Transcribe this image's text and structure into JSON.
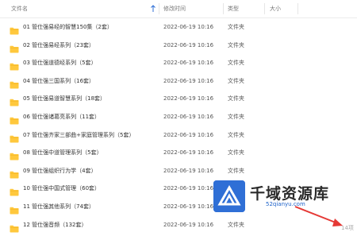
{
  "columns": {
    "name": "文件名",
    "modified": "修改时间",
    "type": "类型",
    "size": "大小"
  },
  "files": [
    {
      "name": "01 管仕强易经的智慧150集（2套）",
      "modified": "2022-06-19 10:16",
      "type": "文件夹"
    },
    {
      "name": "02 管仕强易经系列（23套）",
      "modified": "2022-06-19 10:16",
      "type": "文件夹"
    },
    {
      "name": "03 管仕强道德经系列（5套）",
      "modified": "2022-06-19 10:16",
      "type": "文件夹"
    },
    {
      "name": "04 管仕强三国系列（16套）",
      "modified": "2022-06-19 10:16",
      "type": "文件夹"
    },
    {
      "name": "05 管仕强易道智慧系列（18套）",
      "modified": "2022-06-19 10:16",
      "type": "文件夹"
    },
    {
      "name": "06 管仕强诸葛亮系列（11套）",
      "modified": "2022-06-19 10:16",
      "type": "文件夹"
    },
    {
      "name": "07 管仕强齐家三部曲+家庭管理系列（5套）",
      "modified": "2022-06-19 10:16",
      "type": "文件夹"
    },
    {
      "name": "08 管仕强中道管理系列（5套）",
      "modified": "2022-06-19 10:16",
      "type": "文件夹"
    },
    {
      "name": "09 管仕强组织行为学（4套）",
      "modified": "2022-06-19 10:16",
      "type": "文件夹"
    },
    {
      "name": "10 管仕强中国式管理（60套）",
      "modified": "2022-06-19 10:16",
      "type": "文件夹"
    },
    {
      "name": "11 管仕强其他系列（74套）",
      "modified": "2022-06-19 10:16",
      "type": "文件夹"
    },
    {
      "name": "12 管仕强音频（132套）",
      "modified": "2022-06-19 10:16",
      "type": "文件夹"
    }
  ],
  "watermark": {
    "title": "千域资源库",
    "url": "52qianyu.com"
  },
  "item_count": "14项",
  "colors": {
    "folder": "#ffc83d",
    "accent": "#1e62c9",
    "arrow": "#e53935"
  }
}
